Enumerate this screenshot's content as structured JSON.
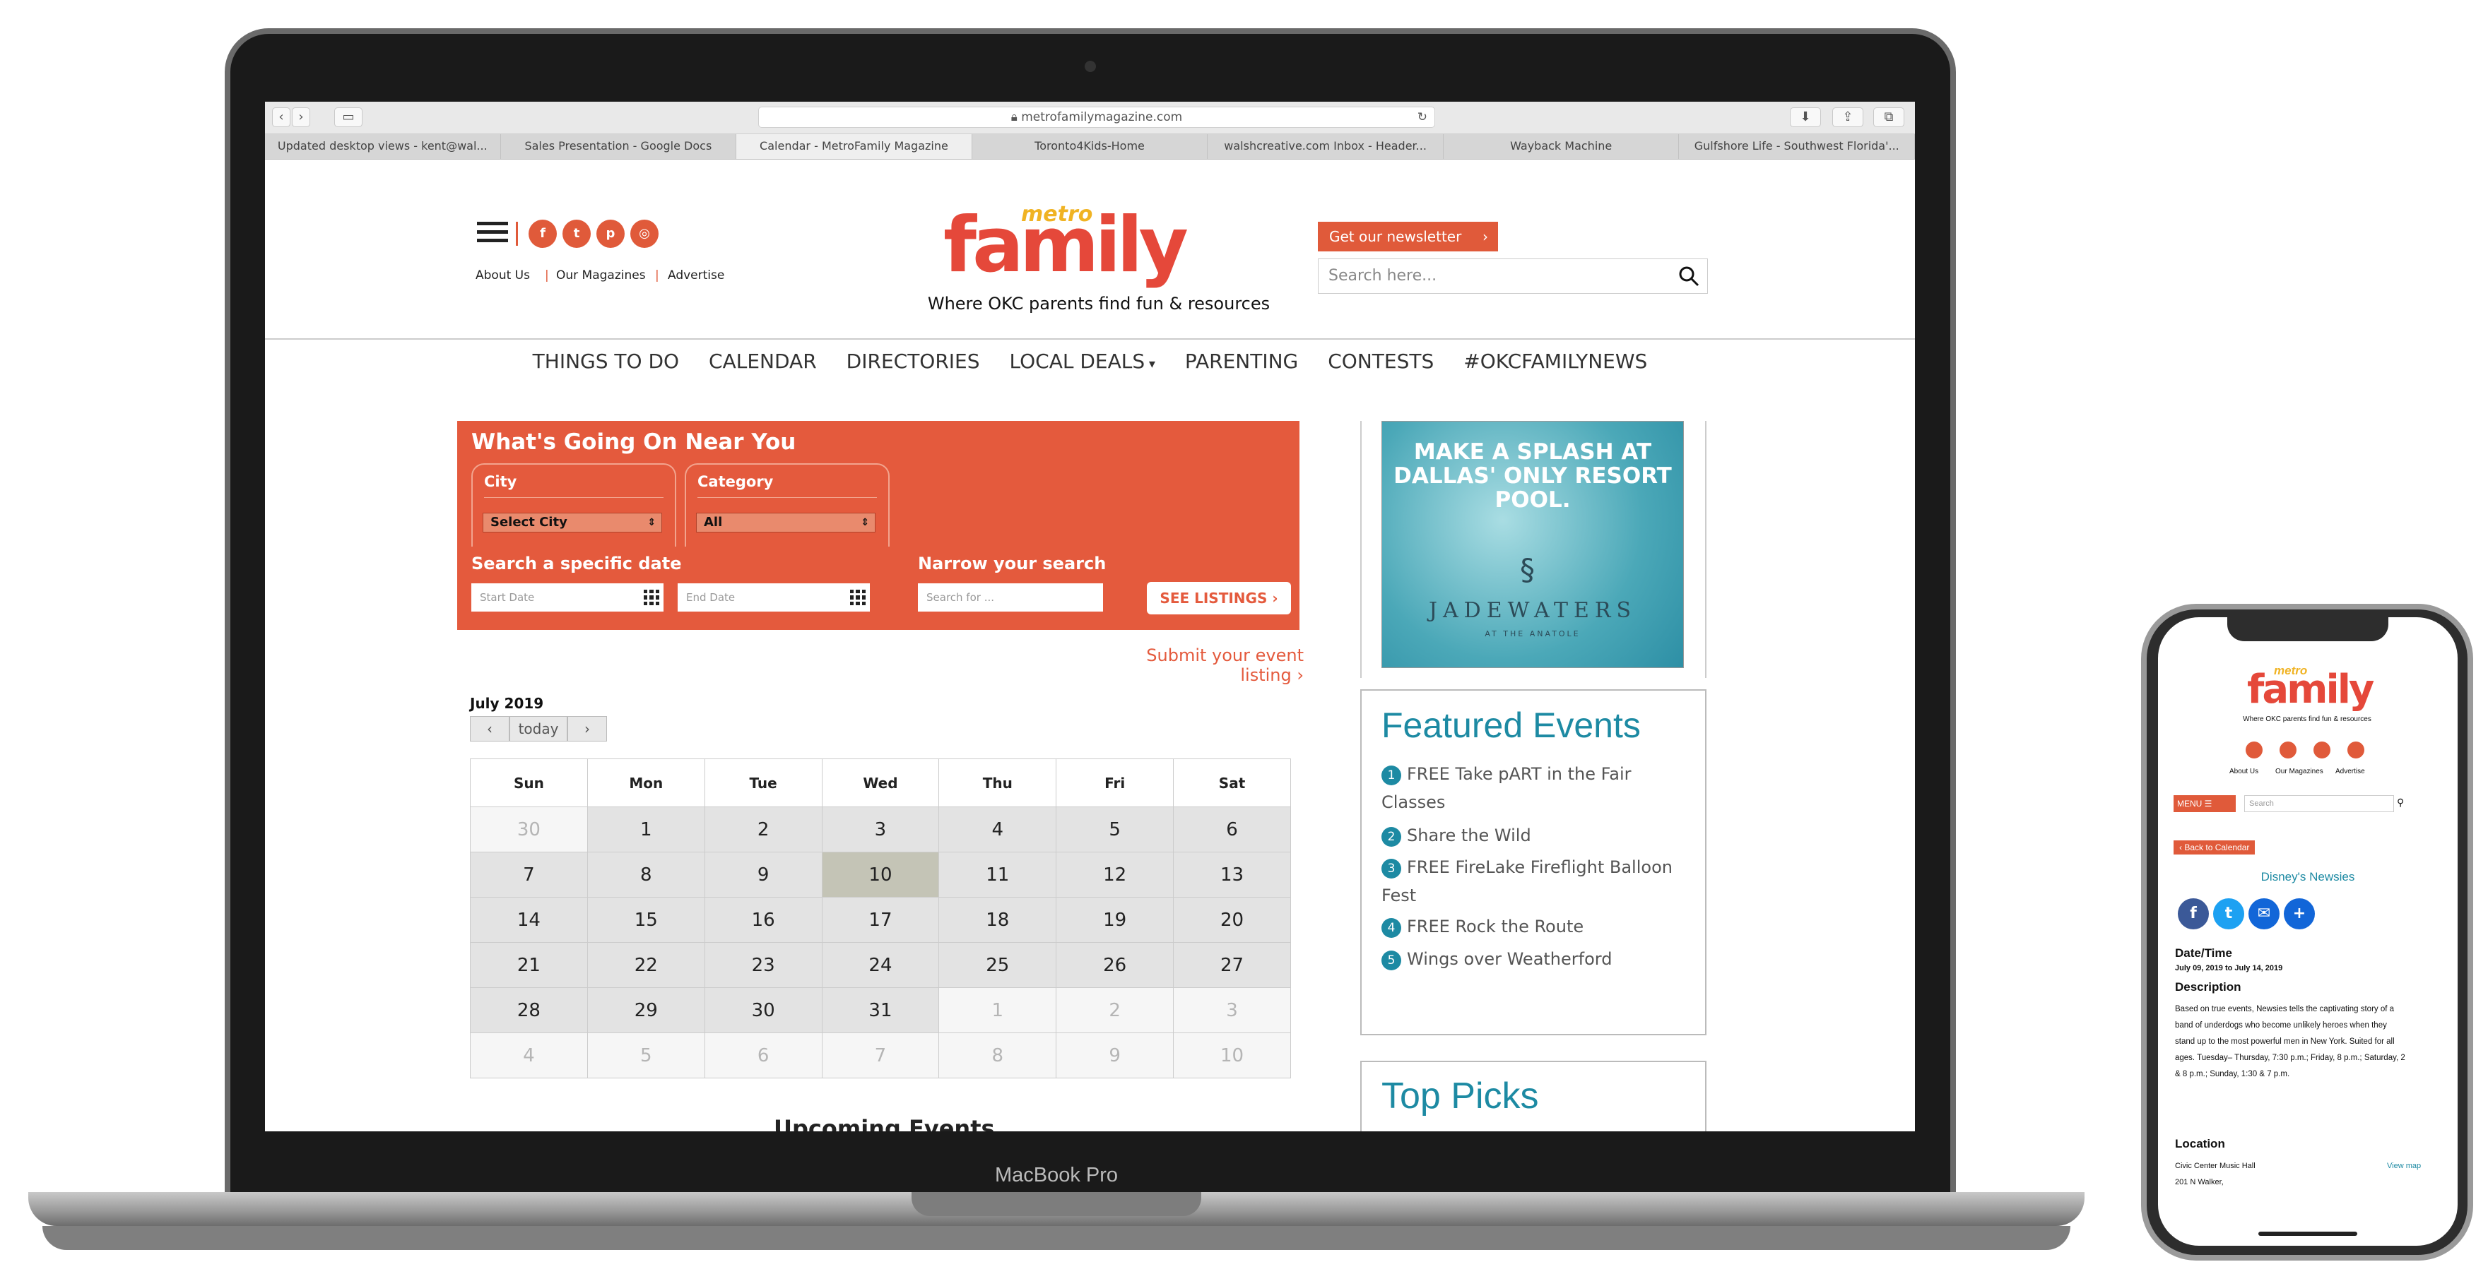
{
  "device": {
    "laptop_label": "MacBook Pro"
  },
  "browser": {
    "url": "metrofamilymagazine.com",
    "tabs": [
      "Updated desktop views - kent@wal...",
      "Sales Presentation - Google Docs",
      "Calendar - MetroFamily Magazine",
      "Toronto4Kids-Home",
      "walshcreative.com Inbox - Header...",
      "Wayback Machine",
      "Gulfshore Life - Southwest Florida'..."
    ],
    "active_tab": 2
  },
  "header": {
    "links": [
      "About Us",
      "Our Magazines",
      "Advertise"
    ],
    "logo_top": "metro",
    "logo_main": "family",
    "tagline": "Where OKC parents find fun & resources",
    "newsletter_label": "Get our newsletter",
    "search_placeholder": "Search here...",
    "social_icons": [
      "facebook-icon",
      "twitter-icon",
      "pinterest-icon",
      "instagram-icon"
    ]
  },
  "nav": [
    "THINGS TO DO",
    "CALENDAR",
    "DIRECTORIES",
    "LOCAL DEALS",
    "PARENTING",
    "CONTESTS",
    "#OKCFAMILYNEWS"
  ],
  "finder": {
    "title": "What's Going On Near You",
    "city_label": "City",
    "city_value": "Select City",
    "category_label": "Category",
    "category_value": "All",
    "date_heading": "Search a specific date",
    "start_placeholder": "Start Date",
    "end_placeholder": "End Date",
    "narrow_heading": "Narrow your search",
    "search_placeholder": "Search for ...",
    "button": "SEE LISTINGS",
    "submit_link": "Submit your event listing"
  },
  "calendar": {
    "month": "July 2019",
    "today_label": "today",
    "days": [
      "Sun",
      "Mon",
      "Tue",
      "Wed",
      "Thu",
      "Fri",
      "Sat"
    ],
    "weeks": [
      [
        [
          "30",
          1
        ],
        [
          "1",
          0
        ],
        [
          "2",
          0
        ],
        [
          "3",
          0
        ],
        [
          "4",
          0
        ],
        [
          "5",
          0
        ],
        [
          "6",
          0
        ]
      ],
      [
        [
          "7",
          0
        ],
        [
          "8",
          0
        ],
        [
          "9",
          0
        ],
        [
          "10",
          2
        ],
        [
          "11",
          0
        ],
        [
          "12",
          0
        ],
        [
          "13",
          0
        ]
      ],
      [
        [
          "14",
          0
        ],
        [
          "15",
          0
        ],
        [
          "16",
          0
        ],
        [
          "17",
          0
        ],
        [
          "18",
          0
        ],
        [
          "19",
          0
        ],
        [
          "20",
          0
        ]
      ],
      [
        [
          "21",
          0
        ],
        [
          "22",
          0
        ],
        [
          "23",
          0
        ],
        [
          "24",
          0
        ],
        [
          "25",
          0
        ],
        [
          "26",
          0
        ],
        [
          "27",
          0
        ]
      ],
      [
        [
          "28",
          0
        ],
        [
          "29",
          0
        ],
        [
          "30",
          0
        ],
        [
          "31",
          0
        ],
        [
          "1",
          1
        ],
        [
          "2",
          1
        ],
        [
          "3",
          1
        ]
      ],
      [
        [
          "4",
          1
        ],
        [
          "5",
          1
        ],
        [
          "6",
          1
        ],
        [
          "7",
          1
        ],
        [
          "8",
          1
        ],
        [
          "9",
          1
        ],
        [
          "10",
          1
        ]
      ]
    ],
    "upcoming_title": "Upcoming Events"
  },
  "ad": {
    "headline": "MAKE A SPLASH AT DALLAS' ONLY RESORT POOL.",
    "brand": "JADEWATERS",
    "subbrand": "AT THE ANATOLE"
  },
  "featured": {
    "title": "Featured Events",
    "items": [
      "FREE Take pART in the Fair Classes",
      "Share the Wild",
      "FREE FireLake Fireflight Balloon Fest",
      "FREE Rock the Route",
      "Wings over Weatherford"
    ]
  },
  "top_picks": {
    "title": "Top Picks"
  },
  "phone": {
    "logo_top": "metro",
    "logo_main": "family",
    "tagline": "Where OKC parents find fun & resources",
    "links": [
      "About Us",
      "Our Magazines",
      "Advertise"
    ],
    "menu_label": "MENU",
    "search_placeholder": "Search",
    "back_label": "Back to Calendar",
    "event_title": "Disney's Newsies",
    "datetime_heading": "Date/Time",
    "datetime_value": "July 09, 2019 to July 14, 2019",
    "description_heading": "Description",
    "description": "Based on true events, Newsies tells the captivating story of a band of underdogs who become unlikely heroes when they stand up to the most powerful men in New York. Suited for all ages. Tuesday– Thursday, 7:30 p.m.; Friday, 8 p.m.; Saturday, 2 & 8 p.m.; Sunday, 1:30 & 7 p.m.",
    "location_heading": "Location",
    "location_name": "Civic Center Music Hall",
    "location_address": "201 N Walker,",
    "view_map": "View map"
  }
}
